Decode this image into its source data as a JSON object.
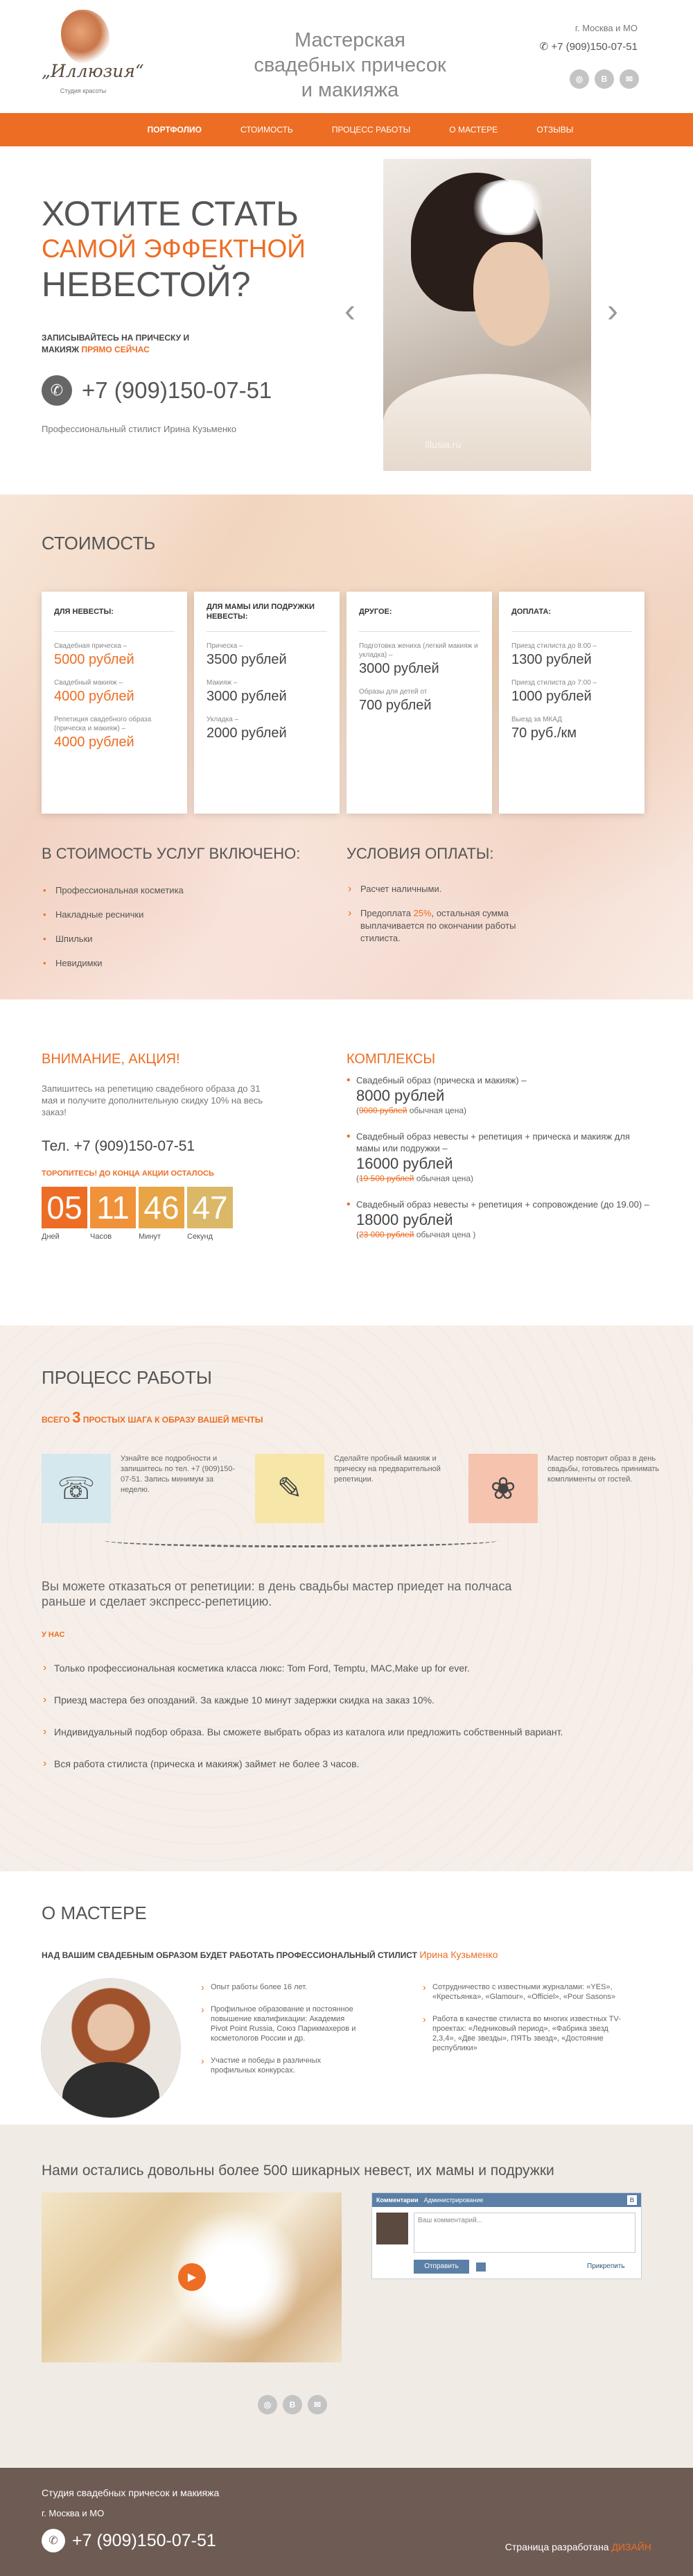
{
  "header": {
    "logo_name": "„Иллюзия“",
    "logo_sub": "Студия красоты",
    "tagline": "Мастерская свадебных причесок и макияжа",
    "city": "г. Москва и МО",
    "phone": "+7 (909)150-07-51",
    "social": [
      {
        "icon": "instagram-icon",
        "glyph": "◎"
      },
      {
        "icon": "vk-icon",
        "glyph": "В"
      },
      {
        "icon": "mail-icon",
        "glyph": "✉"
      }
    ]
  },
  "nav": {
    "items": [
      {
        "label": "Портфолио",
        "active": true
      },
      {
        "label": "Стоимость",
        "active": false
      },
      {
        "label": "Процесс работы",
        "active": false
      },
      {
        "label": "О мастере",
        "active": false
      },
      {
        "label": "Отзывы",
        "active": false
      }
    ]
  },
  "hero": {
    "title_1": "ХОТИТЕ СТАТЬ",
    "title_accent": "САМОЙ ЭФФЕКТНОЙ",
    "title_2": "НЕВЕСТОЙ?",
    "sub_1": "ЗАПИСЫВАЙТЕСЬ НА ПРИЧЕСКУ И МАКИЯЖ",
    "sub_now": "ПРЯМО СЕЙЧАС",
    "phone": "+7 (909)150-07-51",
    "stylist": "Профессиональный стилист Ирина Кузьменко",
    "photo_watermark": "Illusia.ru",
    "arrow_left": "‹",
    "arrow_right": "›"
  },
  "prices": {
    "title": "Стоимость",
    "cards": [
      {
        "head": "Для невесты:",
        "items": [
          {
            "label": "Свадебная прическа –",
            "price": "5000 рублей",
            "hot": true
          },
          {
            "label": "Свадебный макияж –",
            "price": "4000 рублей",
            "hot": true
          },
          {
            "label": "Репетиция свадебного образа (прическа и макияж) –",
            "price": "4000 рублей",
            "hot": true
          }
        ]
      },
      {
        "head": "Для мамы или подружки невесты:",
        "items": [
          {
            "label": "Прическа –",
            "price": "3500 рублей",
            "hot": false
          },
          {
            "label": "Макияж –",
            "price": "3000 рублей",
            "hot": false
          },
          {
            "label": "Укладка –",
            "price": "2000 рублей",
            "hot": false
          }
        ]
      },
      {
        "head": "Другое:",
        "items": [
          {
            "label": "Подготовка жениха (легкий макияж и укладка) –",
            "price": "3000 рублей",
            "hot": false
          },
          {
            "label": "Образы для детей от",
            "price": "700 рублей",
            "hot": false
          }
        ]
      },
      {
        "head": "Доплата:",
        "items": [
          {
            "label": "Приезд стилиста до 8:00 –",
            "price": "1300 рублей",
            "hot": false
          },
          {
            "label": "Приезд стилиста до 7:00 –",
            "price": "1000 рублей",
            "hot": false
          },
          {
            "label": "Выезд за МКАД",
            "price": "70 руб./км",
            "hot": false
          }
        ]
      }
    ],
    "included_title": "В стоимость услуг включено:",
    "included": [
      "Профессиональная косметика",
      "Накладные реснички",
      "Шпильки",
      "Невидимки"
    ],
    "payment_title": "Условия оплаты:",
    "payment_1": "Расчет наличными.",
    "payment_2_a": "Предоплата ",
    "payment_2_hl": "25%",
    "payment_2_b": ", остальная сумма выплачивается по окончании работы стилиста."
  },
  "action": {
    "title": "Внимание, акция!",
    "text": "Запишитесь на репетицию свадебного образа до 31 мая и получите дополнительную скидку 10% на весь заказ!",
    "tel": "Тел. +7 (909)150-07-51",
    "until": "Торопитесь! До конца акции осталось",
    "timer": [
      {
        "value": "05",
        "label": "Дней",
        "color": "#ed6d24"
      },
      {
        "value": "11",
        "label": "Часов",
        "color": "#f0923a"
      },
      {
        "value": "46",
        "label": "Минут",
        "color": "#e7a545"
      },
      {
        "value": "47",
        "label": "Секунд",
        "color": "#dbb768"
      }
    ],
    "combo_title": "Комплексы",
    "combos": [
      {
        "name": "Свадебный образ (прическа и макияж) –",
        "price": "8000 рублей",
        "old": "9000 рублей",
        "old_suffix": " обычная цена)"
      },
      {
        "name": "Свадебный образ невесты + репетиция + прическа и макияж для мамы или подружки –",
        "price": "16000 рублей",
        "old": "19 500 рублей",
        "old_suffix": " обычная цена)"
      },
      {
        "name": "Свадебный образ невесты + репетиция + сопровождение (до 19.00) –",
        "price": "18000 рублей",
        "old": "23 000 рублей",
        "old_suffix": " обычная цена )"
      }
    ]
  },
  "process": {
    "title": "Процесс работы",
    "steps_pre": "Всего ",
    "steps_num": "3",
    "steps_post": " простых шага к образу вашей мечты",
    "steps": [
      {
        "icon": "phone-icon",
        "glyph": "☏",
        "bg": "#d5e8ee",
        "text": "Узнайте все подробности и запишитесь по тел. +7 (909)150-07-51. Запись минимум за неделю."
      },
      {
        "icon": "hairstyle-sketch-icon",
        "glyph": "✎",
        "bg": "#f6e7a8",
        "text": "Сделайте пробный макияж и прическу на предварительной репетиции."
      },
      {
        "icon": "bride-sketch-icon",
        "glyph": "❀",
        "bg": "#f6c3ae",
        "text": "Мастер повторит образ в день свадьбы, готовьтесь принимать комплименты от гостей."
      }
    ],
    "note": "Вы можете отказаться от репетиции: в день свадьбы мастер приедет на полчаса раньше и сделает экспресс-репетицию.",
    "us_title": "У нас",
    "us_list": [
      "Только профессиональная косметика класса люкс: Tom Ford, Temptu, MAC,Make up for ever.",
      "Приезд мастера без опозданий. За каждые 10 минут задержки скидка на заказ 10%.",
      "Индивидуальный подбор образа. Вы сможете выбрать образ из каталога или предложить собственный вариант.",
      "Вся работа стилиста (прическа и макияж) займет не более 3 часов."
    ]
  },
  "master": {
    "title": "О мастере",
    "lead": "Над вашим свадебным образом будет работать профессиональный стилист ",
    "name": "Ирина Кузьменко",
    "list_1": [
      "Опыт работы более 16 лет.",
      "Профильное образование и постоянное повышение квалификации: Академия Pivot Point Russia, Союз Парикмахеров и косметологов России и др.",
      "Участие и победы в различных профильных конкурсах."
    ],
    "list_2": [
      "Сотрудничество с известными журналами: «YES», «Крестьянка», «Glamour», «Officiel», «Pour Sasons»",
      "Работа в качестве стилиста во многих известных TV-проектах: «Ледниковый период», «Фабрика звезд 2,3,4», «Две звезды», ПЯТЬ звезд», «Достояние республики»"
    ]
  },
  "reviews": {
    "title": "Нами остались довольны более 500 шикарных невест, их мамы и подружки",
    "play": "▶",
    "vk_head": "Комментарии",
    "vk_head_2": "Администрирование",
    "vk_b": "В",
    "vk_placeholder": "Ваш комментарий...",
    "vk_send": "Отправить",
    "vk_attach": "Прикрепить"
  },
  "footer": {
    "studio": "Студия свадебных причесок и макияжа",
    "city": "г. Москва и МО",
    "phone": "+7 (909)150-07-51",
    "dev_pre": "Страница разработана",
    "dev_name": "ДИЗАЙН"
  }
}
